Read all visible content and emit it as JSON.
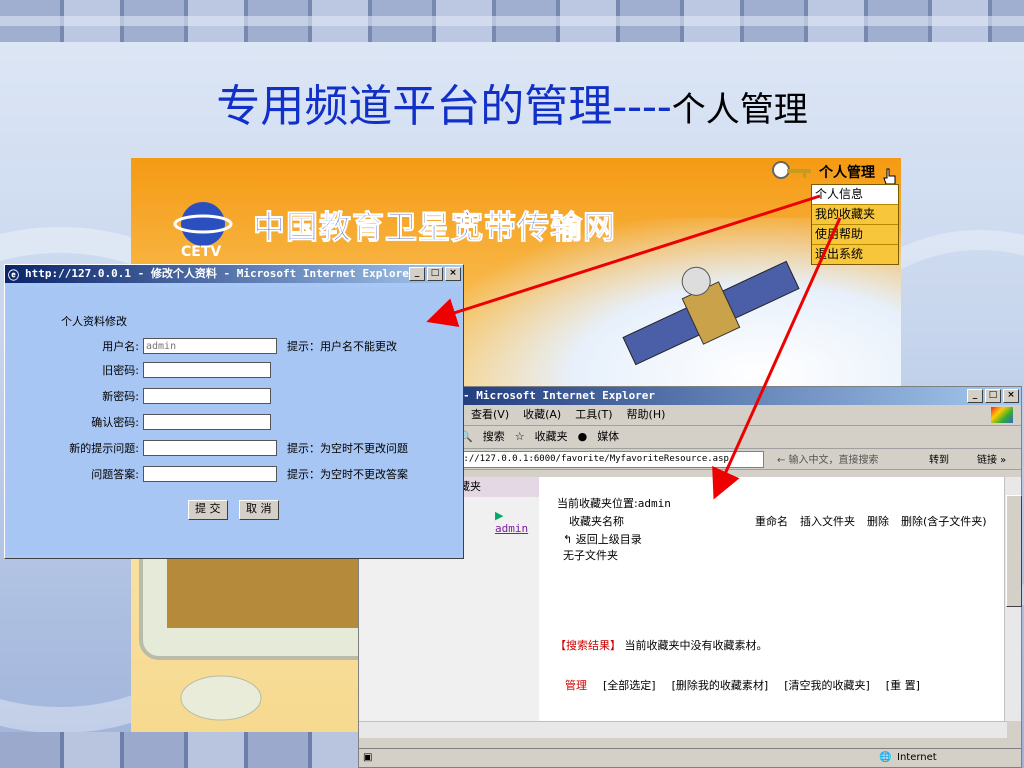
{
  "slide": {
    "title_main": "专用频道平台的管理----",
    "title_sub": "个人管理"
  },
  "portal": {
    "site_title": "中国教育卫星宽带传输网",
    "logo_text": "CETV",
    "menu_trigger": "个人管理",
    "menu_items": [
      "个人信息",
      "我的收藏夹",
      "使用帮助",
      "退出系统"
    ]
  },
  "profile_window": {
    "title": "http://127.0.0.1 - 修改个人资料 - Microsoft Internet Explorer",
    "heading": "个人资料修改",
    "fields": [
      {
        "label": "用户名:",
        "value": "admin",
        "tip": "提示：用户名不能更改"
      },
      {
        "label": "旧密码:",
        "value": "",
        "tip": ""
      },
      {
        "label": "新密码:",
        "value": "",
        "tip": ""
      },
      {
        "label": "确认密码:",
        "value": "",
        "tip": ""
      },
      {
        "label": "新的提示问题:",
        "value": "",
        "tip": "提示：为空时不更改问题"
      },
      {
        "label": "问题答案:",
        "value": "",
        "tip": "提示：为空时不更改答案"
      }
    ],
    "submit": "提 交",
    "cancel": "取 消"
  },
  "favorites_window": {
    "title": "- Microsoft Internet Explorer",
    "menus": [
      "查看(V)",
      "收藏(A)",
      "工具(T)",
      "帮助(H)"
    ],
    "toolbar": [
      "搜索",
      "收藏夹",
      "媒体"
    ],
    "address": "p://127.0.0.1:6000/favorite/MyfavoriteResource.asp",
    "search_hint": "← 输入中文，直接搜索",
    "go": "转到",
    "links": "链接 »",
    "left_header": "藏夹",
    "tree_user": "admin",
    "location_label": "当前收藏夹位置:",
    "location_value": "admin",
    "col_name": "收藏夹名称",
    "col_actions": [
      "重命名",
      "插入文件夹",
      "删除",
      "删除(含子文件夹)"
    ],
    "back_link": "返回上级目录",
    "no_subfolder": "无子文件夹",
    "search_result_label": "【搜索结果】",
    "search_result_text": "当前收藏夹中没有收藏素材。",
    "bottom_links": [
      "管理",
      "[全部选定]",
      "[删除我的收藏素材]",
      "[清空我的收藏夹]",
      "[重 置]"
    ],
    "status_zone": "Internet"
  }
}
